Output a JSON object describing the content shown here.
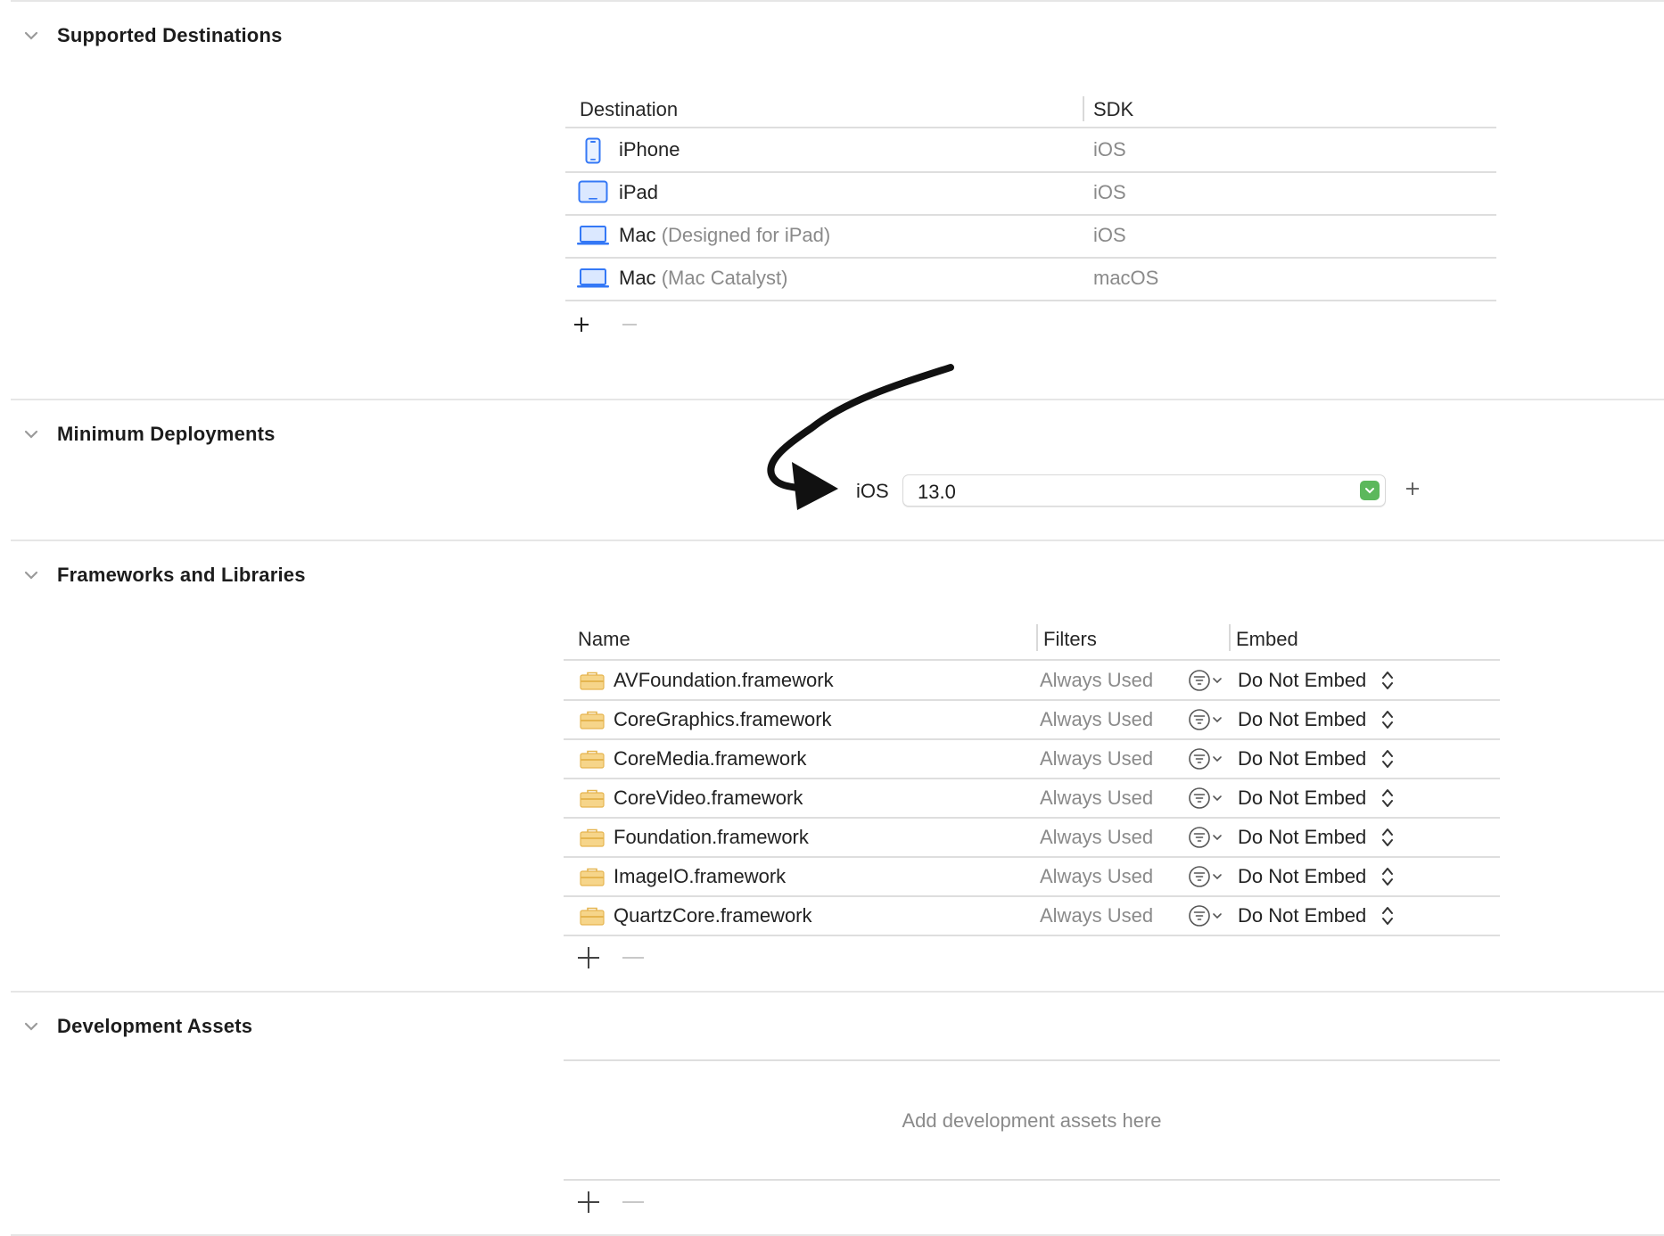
{
  "sections": {
    "supported": {
      "title": "Supported Destinations"
    },
    "min_deploy": {
      "title": "Minimum Deployments"
    },
    "frameworks": {
      "title": "Frameworks and Libraries"
    },
    "dev_assets": {
      "title": "Development Assets"
    }
  },
  "destinations": {
    "headers": {
      "destination": "Destination",
      "sdk": "SDK"
    },
    "rows": [
      {
        "icon": "iphone-icon",
        "name": "iPhone",
        "detail": "",
        "sdk": "iOS"
      },
      {
        "icon": "ipad-icon",
        "name": "iPad",
        "detail": "",
        "sdk": "iOS"
      },
      {
        "icon": "mac-laptop-icon",
        "name": "Mac",
        "detail": "(Designed for iPad)",
        "sdk": "iOS"
      },
      {
        "icon": "mac-laptop-icon",
        "name": "Mac",
        "detail": "(Mac Catalyst)",
        "sdk": "macOS"
      }
    ],
    "add": "+",
    "remove": "—"
  },
  "deployment": {
    "platform": "iOS",
    "version": "13.0",
    "add": "+"
  },
  "frameworks": {
    "headers": {
      "name": "Name",
      "filters": "Filters",
      "embed": "Embed"
    },
    "rows": [
      {
        "name": "AVFoundation.framework",
        "filter": "Always Used",
        "embed": "Do Not Embed"
      },
      {
        "name": "CoreGraphics.framework",
        "filter": "Always Used",
        "embed": "Do Not Embed"
      },
      {
        "name": "CoreMedia.framework",
        "filter": "Always Used",
        "embed": "Do Not Embed"
      },
      {
        "name": "CoreVideo.framework",
        "filter": "Always Used",
        "embed": "Do Not Embed"
      },
      {
        "name": "Foundation.framework",
        "filter": "Always Used",
        "embed": "Do Not Embed"
      },
      {
        "name": "ImageIO.framework",
        "filter": "Always Used",
        "embed": "Do Not Embed"
      },
      {
        "name": "QuartzCore.framework",
        "filter": "Always Used",
        "embed": "Do Not Embed"
      }
    ],
    "add": "+",
    "remove": "—"
  },
  "dev_assets": {
    "placeholder": "Add development assets here",
    "add": "+",
    "remove": "—"
  },
  "colors": {
    "accent_blue": "#3478f6",
    "popup_green": "#5cb85c",
    "framework_icon": "#f3c96b",
    "separator": "#e6e6e6",
    "muted_text": "#8a8a8a"
  }
}
